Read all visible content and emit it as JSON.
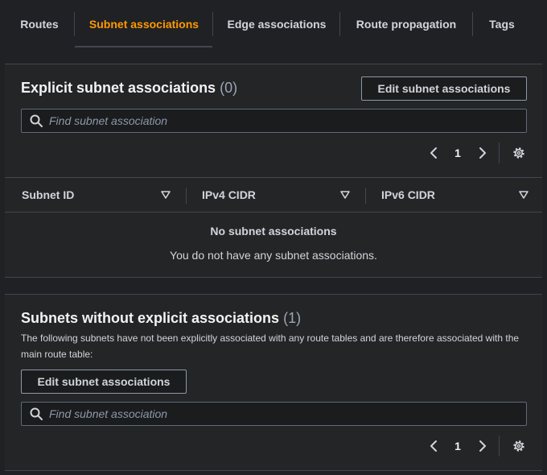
{
  "tabs": [
    {
      "label": "Routes"
    },
    {
      "label": "Subnet associations"
    },
    {
      "label": "Edge associations"
    },
    {
      "label": "Route propagation"
    },
    {
      "label": "Tags"
    }
  ],
  "active_tab": "Subnet associations",
  "explicit": {
    "title": "Explicit subnet associations",
    "count": "(0)",
    "edit_button": "Edit subnet associations",
    "search_placeholder": "Find subnet association",
    "page": "1",
    "columns": [
      "Subnet ID",
      "IPv4 CIDR",
      "IPv6 CIDR"
    ],
    "empty_title": "No subnet associations",
    "empty_text": "You do not have any subnet associations."
  },
  "without": {
    "title": "Subnets without explicit associations",
    "count": "(1)",
    "description": "The following subnets have not been explicitly associated with any route tables and are therefore associated with the main route table:",
    "edit_button": "Edit subnet associations",
    "search_placeholder": "Find subnet association",
    "page": "1"
  },
  "colors": {
    "accent": "#ff9900",
    "background": "#1f2124",
    "panel": "#232527",
    "border": "#414750",
    "text": "#d1d5db"
  },
  "icons": {
    "search": "search-icon",
    "prev": "chevron-left-icon",
    "next": "chevron-right-icon",
    "settings": "gear-icon",
    "sort": "sort-down-icon"
  }
}
